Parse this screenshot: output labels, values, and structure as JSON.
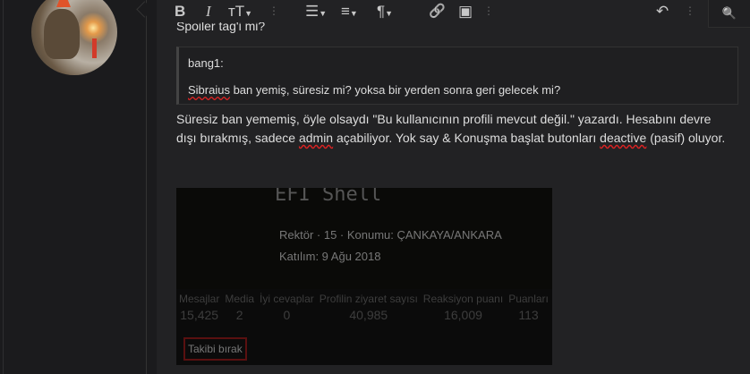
{
  "toolbar": {
    "bold": "B",
    "italic": "I",
    "text_size": "тT",
    "list": "☰",
    "align": "≡",
    "paragraph": "¶",
    "link": "🔗",
    "image": "▣",
    "undo": "↶",
    "more": "⋮",
    "preview": "🔍"
  },
  "editor": {
    "spoiler_line": "Spoiler tag'i mi?",
    "quote": {
      "author": "bang1:",
      "text_misspelled": "Sibraius",
      "text_rest": " ban yemiş, süresiz mi? yoksa bir yerden sonra geri gelecek mi?"
    },
    "paragraph": {
      "p1": "Süresiz ban yememiş, öyle olsaydı \"Bu kullanıcının profili mevcut değil.\" yazardı. Hesabını devre dışı bırakmış, sadece ",
      "w1": "admin",
      "p2": " açabiliyor. Yok say & Konuşma başlat butonları ",
      "w2": "deactive",
      "p3": " (pasif) oluyor."
    }
  },
  "profile_card": {
    "banner_title": "EFI Shell",
    "role_line": "Rektör · 15 · Konumu: ÇANKAYA/ANKARA",
    "joined": "Katılım: 9 Ağu 2018",
    "stats": [
      {
        "label": "Mesajlar",
        "value": "15,425"
      },
      {
        "label": "Media",
        "value": "2"
      },
      {
        "label": "İyi cevaplar",
        "value": "0"
      },
      {
        "label": "Profilin ziyaret sayısı",
        "value": "40,985"
      },
      {
        "label": "Reaksiyon puanı",
        "value": "16,009"
      },
      {
        "label": "Puanları",
        "value": "113"
      }
    ],
    "unfollow": "Takibi bırak"
  }
}
